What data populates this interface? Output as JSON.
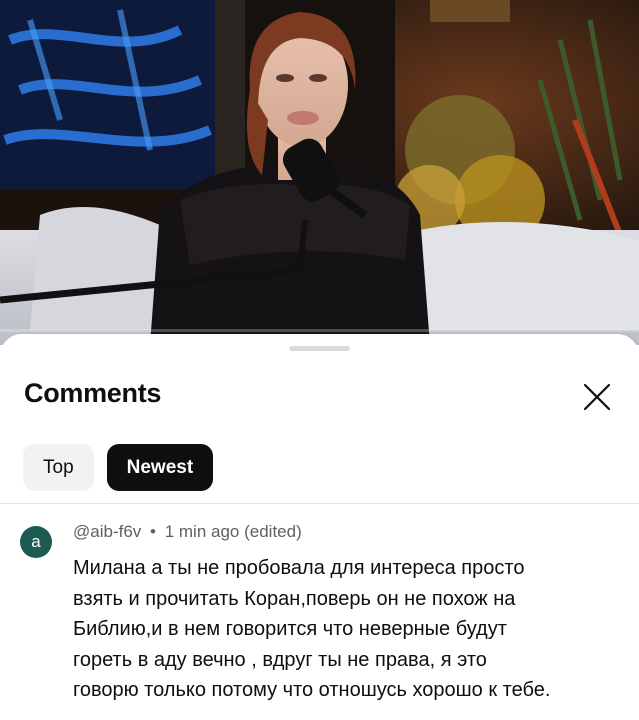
{
  "video": {
    "progress_fraction": 0.0
  },
  "comments_panel": {
    "title": "Comments",
    "close_icon": "close-icon",
    "sort_chips": [
      {
        "label": "Top",
        "selected": false
      },
      {
        "label": "Newest",
        "selected": true
      }
    ]
  },
  "comment": {
    "avatar_letter": "a",
    "avatar_color": "#1e5b55",
    "author": "@aib-f6v",
    "separator": "•",
    "time": "1 min ago (edited)",
    "lines": [
      "Милана а ты не пробовала для интереса просто",
      "взять и прочитать Коран,поверь он не похож на",
      "Библию,и в нем говорится что неверные будут",
      "гореть в аду вечно , вдруг ты не права, я это",
      "говорю только потому что отношусь хорошо к тебе."
    ]
  },
  "colors": {
    "chip_selected_bg": "#0f0f0f",
    "chip_unselected_bg": "#f2f2f2",
    "progress": "#ff0000"
  }
}
